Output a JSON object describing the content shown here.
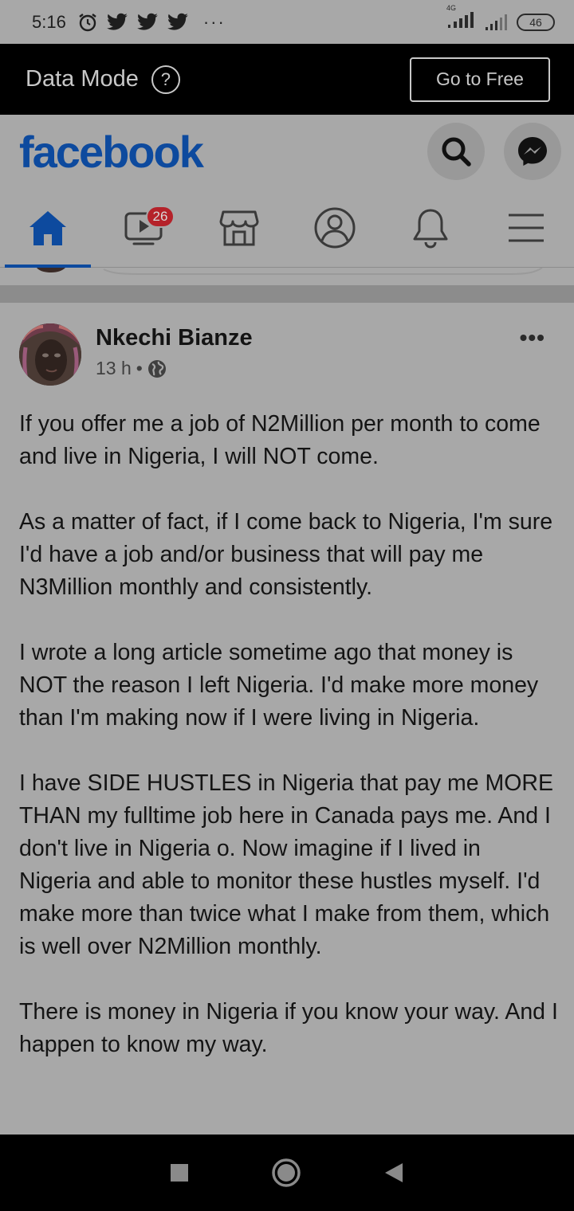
{
  "status_bar": {
    "time": "5:16",
    "network_label": "4G",
    "battery": "46",
    "icons": [
      "alarm-icon",
      "twitter-icon",
      "twitter-icon",
      "twitter-icon",
      "more-dots-icon",
      "signal-icon",
      "signal-icon",
      "battery-icon"
    ]
  },
  "data_mode": {
    "title": "Data Mode",
    "help_icon": "?",
    "go_free_label": "Go to Free"
  },
  "header": {
    "logo": "facebook",
    "brand_color": "#0d4a9e",
    "search_icon": "search-icon",
    "messenger_icon": "messenger-icon"
  },
  "nav": {
    "tabs": [
      {
        "name": "home",
        "icon": "home-icon",
        "active": true
      },
      {
        "name": "watch",
        "icon": "video-icon",
        "badge": "26"
      },
      {
        "name": "marketplace",
        "icon": "store-icon"
      },
      {
        "name": "profile",
        "icon": "profile-icon"
      },
      {
        "name": "notifications",
        "icon": "bell-icon"
      },
      {
        "name": "menu",
        "icon": "menu-icon"
      }
    ]
  },
  "post": {
    "author": "Nkechi Bianze",
    "time": "13 h",
    "separator": "•",
    "privacy_icon": "globe-icon",
    "more": "•••",
    "paragraphs": [
      "If you offer me a job of N2Million per month to come and live in Nigeria, I will NOT come.",
      "As a matter of fact, if I come back to Nigeria, I'm sure I'd have a job and/or business that will pay me N3Million monthly and consistently.",
      "I wrote a long article sometime ago that money is NOT the reason I left Nigeria. I'd make more money than I'm making now if I were living in Nigeria.",
      "I have SIDE HUSTLES in Nigeria that pay me MORE THAN my fulltime job here in Canada pays me. And I don't live in Nigeria o. Now imagine if I lived in Nigeria and able to monitor these hustles myself. I'd make more than twice what I make from them, which is well over N2Million monthly.",
      "There is money in Nigeria if you know your way. And I happen to know my way."
    ]
  },
  "android_nav": {
    "buttons": [
      "recents-button",
      "home-button",
      "back-button"
    ]
  }
}
